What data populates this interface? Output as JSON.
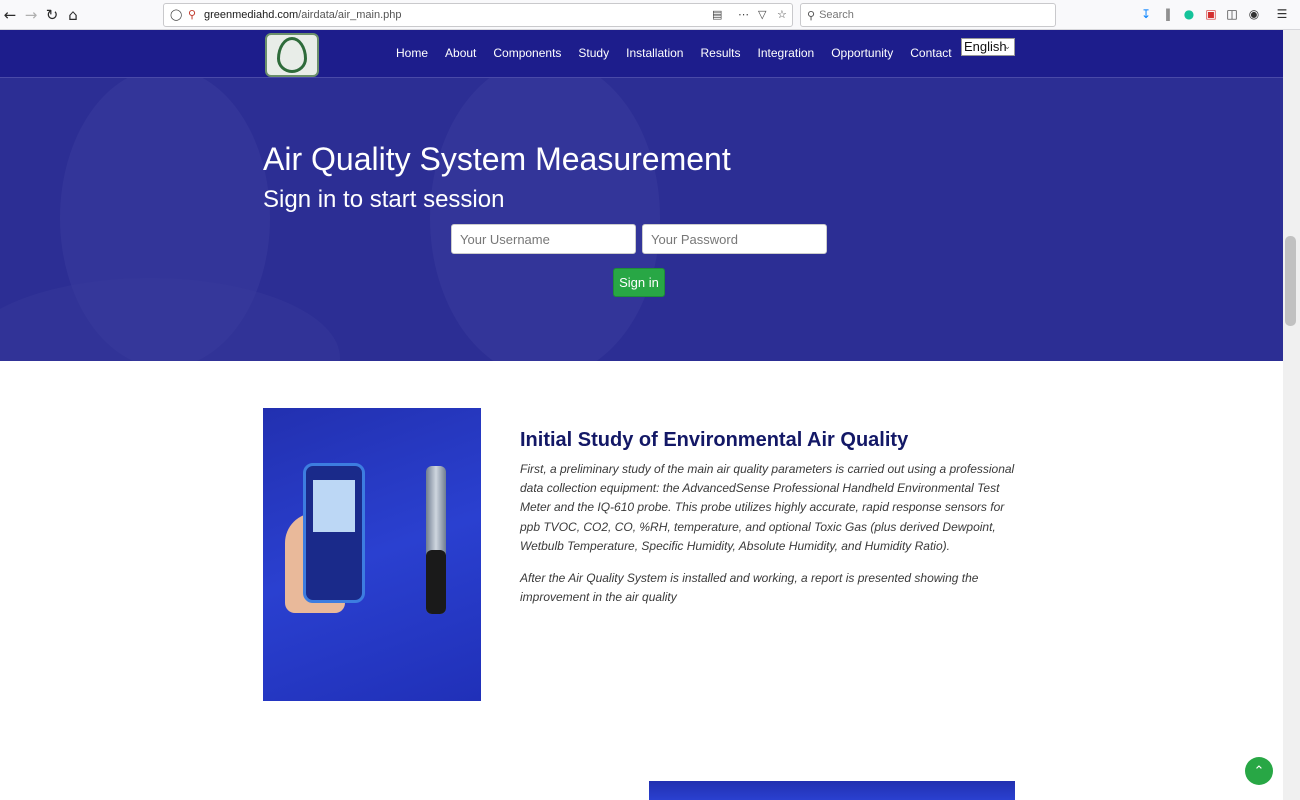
{
  "browser": {
    "url_domain": "greenmediahd.com",
    "url_path": "/airdata/air_main.php",
    "search_placeholder": "Search"
  },
  "nav": {
    "items": [
      "Home",
      "About",
      "Components",
      "Study",
      "Installation",
      "Results",
      "Integration",
      "Opportunity",
      "Contact"
    ],
    "language": "English"
  },
  "hero": {
    "title": "Air Quality System Measurement",
    "subtitle": "Sign in to start session",
    "username_placeholder": "Your Username",
    "password_placeholder": "Your Password",
    "signin_label": "Sign in"
  },
  "study": {
    "title": "Initial Study of Environmental Air Quality",
    "paragraph1": "First, a preliminary study of the main air quality parameters is carried out using a professional data collection equipment: the AdvancedSense Professional Handheld Environmental Test Meter and the IQ-610 probe. This probe utilizes highly accurate, rapid response sensors for ppb TVOC, CO2, CO, %RH, temperature, and optional Toxic Gas (plus derived Dewpoint, Wetbulb Temperature, Specific Humidity, Absolute Humidity, and Humidity Ratio).",
    "paragraph2": "After the Air Quality System is installed and working, a report is presented showing the improvement in the air quality"
  },
  "colors": {
    "nav_bg": "#1d1d8c",
    "hero_bg": "#2c2e94",
    "accent_green": "#28a745",
    "title_navy": "#131866"
  }
}
